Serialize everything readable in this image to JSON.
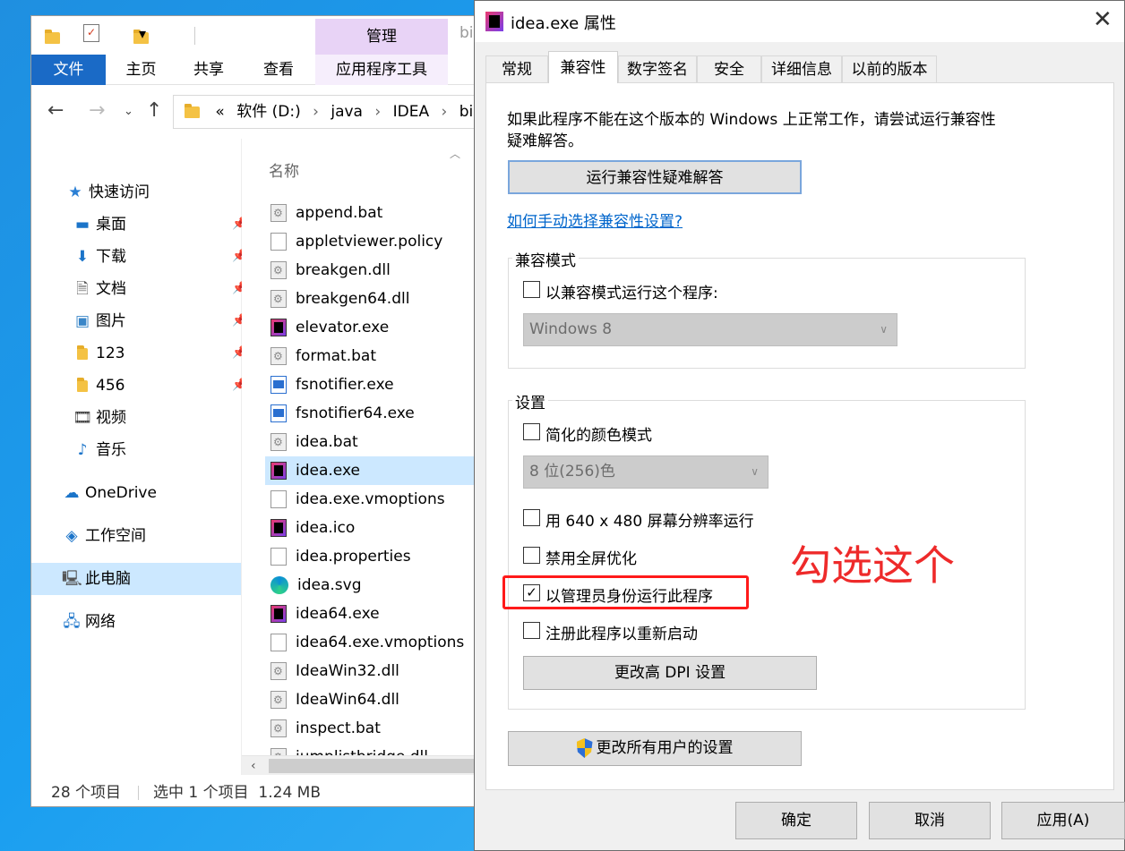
{
  "explorer": {
    "quick_access_toolbar": {
      "dropdown_glyph": "▾"
    },
    "manage_tab": "管理",
    "title_path_fragment": "bi",
    "ribbon_tabs": [
      "文件",
      "主页",
      "共享",
      "查看",
      "应用程序工具"
    ],
    "breadcrumb": {
      "overflow": "«",
      "segments": [
        "软件 (D:)",
        "java",
        "IDEA",
        "bin"
      ]
    },
    "nav_pane": [
      {
        "label": "快速访问",
        "icon": "star-icon",
        "pinned": false
      },
      {
        "label": "桌面",
        "icon": "desktop-icon",
        "pinned": true
      },
      {
        "label": "下载",
        "icon": "download-icon",
        "pinned": true
      },
      {
        "label": "文档",
        "icon": "document-icon",
        "pinned": true
      },
      {
        "label": "图片",
        "icon": "picture-icon",
        "pinned": true
      },
      {
        "label": "123",
        "icon": "folder-icon",
        "pinned": true
      },
      {
        "label": "456",
        "icon": "folder-icon",
        "pinned": true
      },
      {
        "label": "视频",
        "icon": "video-icon",
        "pinned": false
      },
      {
        "label": "音乐",
        "icon": "music-icon",
        "pinned": false
      },
      {
        "label": "OneDrive",
        "icon": "cloud-icon",
        "pinned": false
      },
      {
        "label": "工作空间",
        "icon": "workspace-icon",
        "pinned": false
      },
      {
        "label": "此电脑",
        "icon": "computer-icon",
        "pinned": false,
        "selected": true
      },
      {
        "label": "网络",
        "icon": "network-icon",
        "pinned": false
      }
    ],
    "column_header": "名称",
    "files": [
      {
        "name": "append.bat",
        "type": "bat"
      },
      {
        "name": "appletviewer.policy",
        "type": "doc"
      },
      {
        "name": "breakgen.dll",
        "type": "bat"
      },
      {
        "name": "breakgen64.dll",
        "type": "bat"
      },
      {
        "name": "elevator.exe",
        "type": "exe"
      },
      {
        "name": "format.bat",
        "type": "bat"
      },
      {
        "name": "fsnotifier.exe",
        "type": "win"
      },
      {
        "name": "fsnotifier64.exe",
        "type": "win"
      },
      {
        "name": "idea.bat",
        "type": "bat"
      },
      {
        "name": "idea.exe",
        "type": "exe",
        "selected": true
      },
      {
        "name": "idea.exe.vmoptions",
        "type": "doc"
      },
      {
        "name": "idea.ico",
        "type": "exe"
      },
      {
        "name": "idea.properties",
        "type": "doc"
      },
      {
        "name": "idea.svg",
        "type": "edge"
      },
      {
        "name": "idea64.exe",
        "type": "exe"
      },
      {
        "name": "idea64.exe.vmoptions",
        "type": "doc"
      },
      {
        "name": "IdeaWin32.dll",
        "type": "bat"
      },
      {
        "name": "IdeaWin64.dll",
        "type": "bat"
      },
      {
        "name": "inspect.bat",
        "type": "bat"
      },
      {
        "name": "jumplistbridge.dll",
        "type": "bat"
      }
    ],
    "status": {
      "item_count": "28 个项目",
      "selection": "选中 1 个项目  1.24 MB"
    }
  },
  "dialog": {
    "title": "idea.exe 属性",
    "close_glyph": "✕",
    "tabs": [
      "常规",
      "兼容性",
      "数字签名",
      "安全",
      "详细信息",
      "以前的版本"
    ],
    "active_tab": "兼容性",
    "intro": "如果此程序不能在这个版本的 Windows 上正常工作，请尝试运行兼容性疑难解答。",
    "intro_line1": "如果此程序不能在这个版本的 Windows 上正常工作，请尝试运行兼容性",
    "intro_line2": "疑难解答。",
    "troubleshooter_button": "运行兼容性疑难解答",
    "manual_link": "如何手动选择兼容性设置?",
    "compat_group": {
      "label": "兼容模式",
      "checkbox_label": "以兼容模式运行这个程序:",
      "checked": false,
      "os_value": "Windows 8"
    },
    "settings_group": {
      "label": "设置",
      "reduced_color": {
        "label": "简化的颜色模式",
        "checked": false
      },
      "color_value": "8 位(256)色",
      "run_640": {
        "label": "用 640 x 480 屏幕分辨率运行",
        "checked": false
      },
      "disable_fullscreen": {
        "label": "禁用全屏优化",
        "checked": false
      },
      "run_as_admin": {
        "label": "以管理员身份运行此程序",
        "checked": true
      },
      "register_restart": {
        "label": "注册此程序以重新启动",
        "checked": false
      },
      "dpi_button": "更改高 DPI 设置"
    },
    "all_users_button": "更改所有用户的设置",
    "footer": {
      "ok": "确定",
      "cancel": "取消",
      "apply": "应用(A)"
    },
    "annotation": "勾选这个",
    "colors": {
      "annotation": "#ee2a2a",
      "accent": "#1a6ac6",
      "selection": "#cce8ff",
      "link": "#0066cc"
    }
  }
}
